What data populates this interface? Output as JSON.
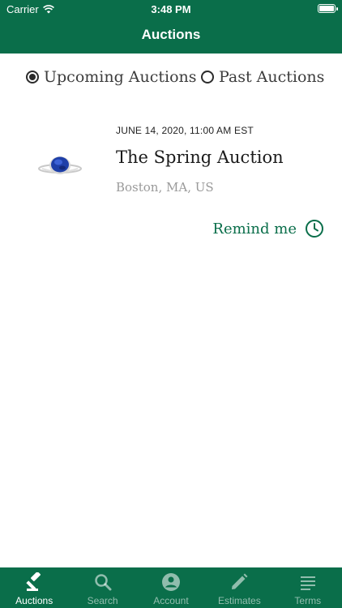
{
  "status": {
    "carrier": "Carrier",
    "time": "3:48 PM"
  },
  "header": {
    "title": "Auctions"
  },
  "filter": {
    "upcoming": "Upcoming Auctions",
    "past": "Past Auctions",
    "selected": "upcoming"
  },
  "auction": {
    "date": "JUNE 14, 2020, 11:00 AM EST",
    "title": "The Spring Auction",
    "location": "Boston, MA, US",
    "remind": "Remind me",
    "image_icon": "sapphire-ring"
  },
  "tabs": [
    {
      "label": "Auctions",
      "icon": "gavel-icon",
      "active": true
    },
    {
      "label": "Search",
      "icon": "search-icon",
      "active": false
    },
    {
      "label": "Account",
      "icon": "account-icon",
      "active": false
    },
    {
      "label": "Estimates",
      "icon": "pencil-icon",
      "active": false
    },
    {
      "label": "Terms",
      "icon": "list-icon",
      "active": false
    }
  ],
  "colors": {
    "brand": "#0a6e4a",
    "text": "#1b1b1b",
    "muted": "#9a9a9a"
  }
}
